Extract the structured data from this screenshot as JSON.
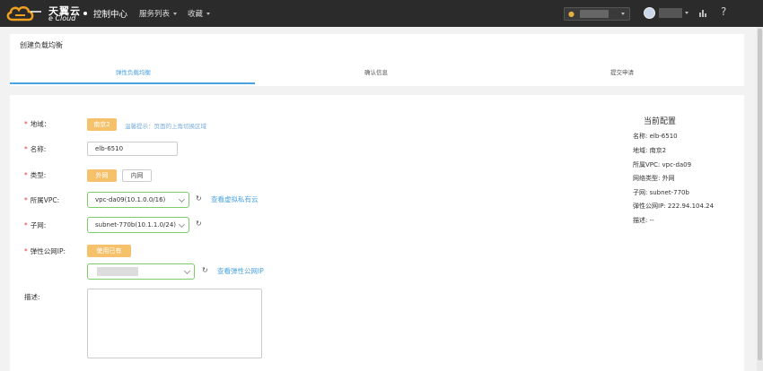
{
  "topbar": {
    "logo_cn": "天翼云",
    "logo_en": "e Cloud",
    "control_center": "控制中心",
    "services": "服务列表",
    "favorites": "收藏",
    "help": "?"
  },
  "page": {
    "title": "创建负载均衡",
    "steps": [
      {
        "label": "弹性负载均衡",
        "active": true
      },
      {
        "label": "确认信息",
        "active": false
      },
      {
        "label": "提交申请",
        "active": false
      }
    ]
  },
  "form": {
    "region_label": "地域：",
    "region_value": "南京2",
    "region_hint": "温馨提示：页面的上角切换区域",
    "name_label": "名称:",
    "name_value": "elb-6510",
    "type_label": "类型:",
    "type_options": [
      "外网",
      "内网"
    ],
    "vpc_label": "所属VPC:",
    "vpc_value": "vpc-da09(10.1.0.0/16)",
    "vpc_link": "查看虚拟私有云",
    "subnet_label": "子网:",
    "subnet_value": "subnet-770b(10.1.1.0/24)",
    "eip_label": "弹性公网IP:",
    "eip_button": "使用已有",
    "eip_link": "查看弹性公网IP",
    "desc_label": "描述:"
  },
  "summary": {
    "title": "当前配置",
    "lines": [
      "名称: elb-6510",
      "地域: 南京2",
      "所属VPC: vpc-da09",
      "网络类型: 外网",
      "子网: subnet-770b",
      "弹性公网IP: 222.94.104.24",
      "描述: --"
    ]
  },
  "colors": {
    "accent": "#4aa3df",
    "button_yellow": "#f5c26b",
    "required": "#e4393c",
    "valid_border": "#7ccd67"
  }
}
